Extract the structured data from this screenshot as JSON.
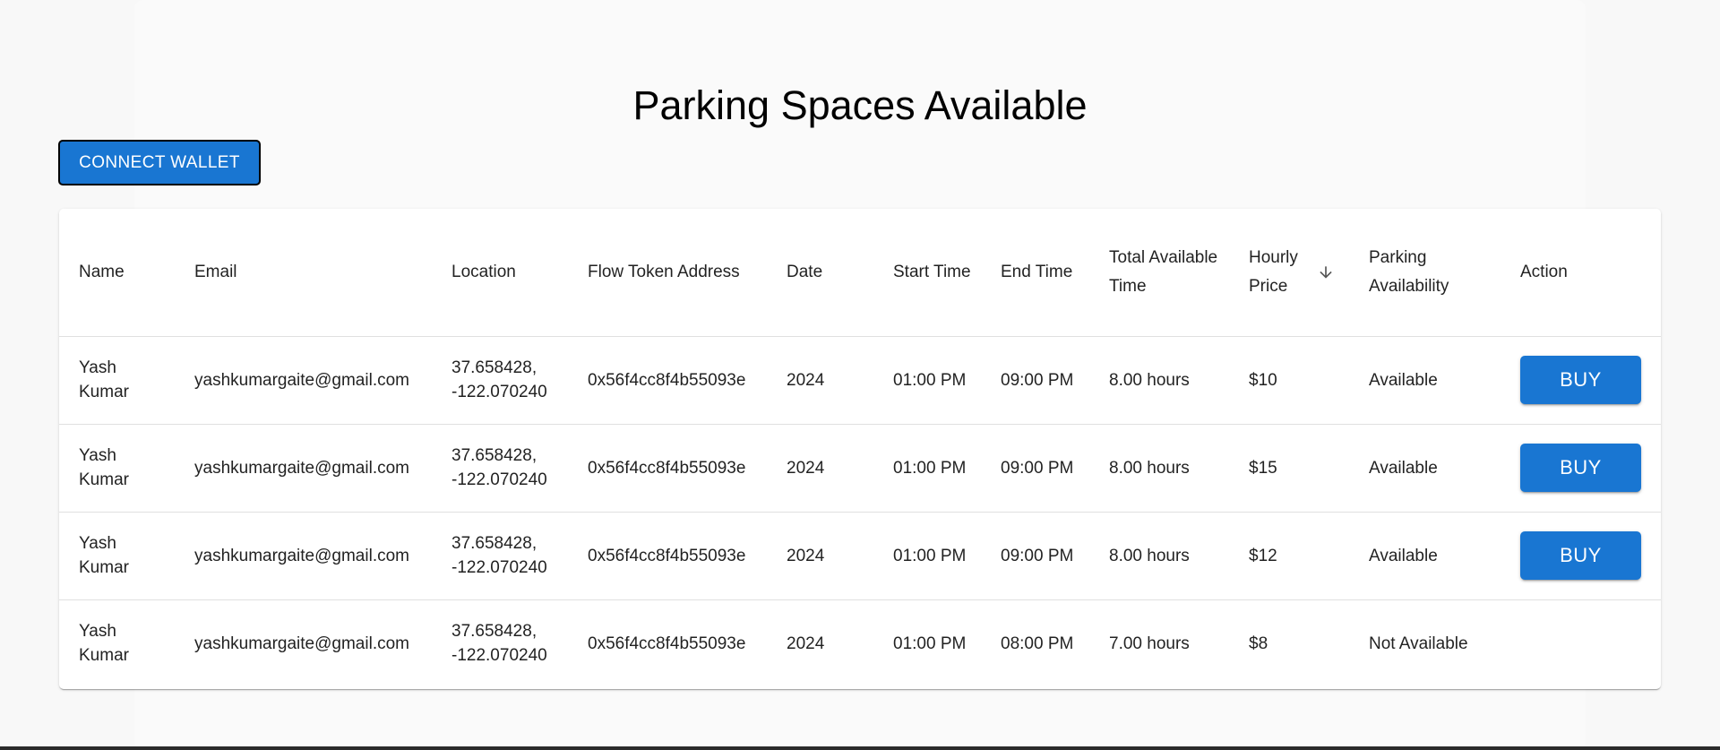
{
  "page": {
    "title": "Parking Spaces Available"
  },
  "toolbar": {
    "connect_wallet_label": "CONNECT WALLET"
  },
  "colors": {
    "primary": "#1976d2",
    "background": "#f8f8f8",
    "card": "#ffffff"
  },
  "table": {
    "headers": {
      "name": "Name",
      "email": "Email",
      "location": "Location",
      "flow_token_address": "Flow Token Address",
      "date": "Date",
      "start_time": "Start Time",
      "end_time": "End Time",
      "total_available_time": "Total Available Time",
      "hourly_price": "Hourly Price",
      "parking_availability": "Parking Availability",
      "action": "Action"
    },
    "sort_icon": "arrow-down-icon",
    "rows": [
      {
        "name": "Yash Kumar",
        "email": "yashkumargaite@gmail.com",
        "location": "37.658428, -122.070240",
        "flow_token_address": "0x56f4cc8f4b55093e",
        "date": "2024",
        "start_time": "01:00 PM",
        "end_time": "09:00 PM",
        "total_available_time": "8.00 hours",
        "hourly_price": "$10",
        "parking_availability": "Available",
        "action_label": "BUY"
      },
      {
        "name": "Yash Kumar",
        "email": "yashkumargaite@gmail.com",
        "location": "37.658428, -122.070240",
        "flow_token_address": "0x56f4cc8f4b55093e",
        "date": "2024",
        "start_time": "01:00 PM",
        "end_time": "09:00 PM",
        "total_available_time": "8.00 hours",
        "hourly_price": "$15",
        "parking_availability": "Available",
        "action_label": "BUY"
      },
      {
        "name": "Yash Kumar",
        "email": "yashkumargaite@gmail.com",
        "location": "37.658428, -122.070240",
        "flow_token_address": "0x56f4cc8f4b55093e",
        "date": "2024",
        "start_time": "01:00 PM",
        "end_time": "09:00 PM",
        "total_available_time": "8.00 hours",
        "hourly_price": "$12",
        "parking_availability": "Available",
        "action_label": "BUY"
      },
      {
        "name": "Yash Kumar",
        "email": "yashkumargaite@gmail.com",
        "location": "37.658428, -122.070240",
        "flow_token_address": "0x56f4cc8f4b55093e",
        "date": "2024",
        "start_time": "01:00 PM",
        "end_time": "08:00 PM",
        "total_available_time": "7.00 hours",
        "hourly_price": "$8",
        "parking_availability": "Not Available",
        "action_label": ""
      }
    ]
  }
}
